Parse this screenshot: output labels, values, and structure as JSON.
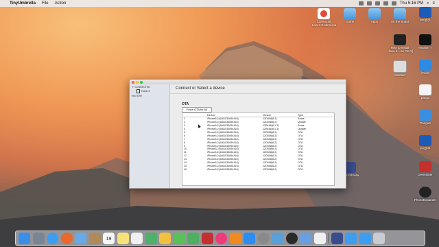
{
  "menubar": {
    "app_name": "TinyUmbrella",
    "items": [
      "File",
      "Action"
    ],
    "clock": "Thu 5:16 PM"
  },
  "desktop_icons": [
    {
      "label": "Cambodia\nLow-1.0.bdmv.ipa"
    },
    {
      "label": "Game"
    },
    {
      "label": "Apps"
    },
    {
      "label": "On the Board"
    },
    {
      "label": "PP助手"
    },
    {
      "label": "How to install\nJava 8....ac OS X]"
    },
    {
      "label": "evasi0n 7"
    },
    {
      "label": "Untitled"
    },
    {
      "label": "iTools"
    },
    {
      "label": "pangu"
    },
    {
      "label": "Pangu8"
    },
    {
      "label": "PP助手"
    },
    {
      "label": "TinyUmbrella"
    },
    {
      "label": "DeviMaker"
    },
    {
      "label": "PhoneExpander"
    }
  ],
  "window": {
    "sidebar": {
      "connected_header": "CONNECTED",
      "device_name": "Thanh 5",
      "history_header": "HISTORY"
    },
    "main_title": "Connect or Select a device",
    "section_title": "OTA",
    "fetch_button": "Fetch OTA for All",
    "table": {
      "columns": [
        "",
        "Device",
        "Version",
        "Type"
      ],
      "rows": [
        [
          "1",
          "iPhone5,2(4461033694416)",
          "12D508(8.2)",
          "Erase"
        ],
        [
          "2",
          "iPhone5,2(4461033694416)",
          "12D508(8.2)",
          "Update"
        ],
        [
          "3",
          "iPhone5,2(4461033694416)",
          "12B466(8.1.3)",
          "Erase"
        ],
        [
          "4",
          "iPhone5,2(4461033694416)",
          "12B466(8.1.3)",
          "Update"
        ],
        [
          "5",
          "iPhone5,2(4461033694416)",
          "12D508(8.2)",
          "OTA"
        ],
        [
          "6",
          "iPhone5,2(4461033694416)",
          "12D508(8.2)",
          "OTA"
        ],
        [
          "7",
          "iPhone5,2(4461033694416)",
          "12D508(8.2)",
          "OTA"
        ],
        [
          "8",
          "iPhone5,2(4461033694416)",
          "12D508(8.2)",
          "OTA"
        ],
        [
          "9",
          "iPhone5,2(4461033694416)",
          "12D508(8.2)",
          "OTA"
        ],
        [
          "10",
          "iPhone5,2(4461033694416)",
          "12D508(8.2)",
          "OTA"
        ],
        [
          "11",
          "iPhone5,2(4461033694416)",
          "12D508(8.2)",
          "OTA"
        ],
        [
          "12",
          "iPhone5,2(4461033694416)",
          "12D508(8.2)",
          "OTA"
        ],
        [
          "13",
          "iPhone5,2(4461033694416)",
          "12D508(8.2)",
          "OTA"
        ],
        [
          "14",
          "iPhone5,2(4461033694416)",
          "12D508(8.2)",
          "OTA"
        ],
        [
          "15",
          "iPhone5,2(4461033694416)",
          "12D508(8.2)",
          "OTA"
        ],
        [
          "16",
          "iPhone5,2(4461033694416)",
          "12D508(8.2)",
          "OTA"
        ]
      ]
    }
  },
  "dock": {
    "icons": [
      "finder-icon",
      "launchpad-icon",
      "safari-icon",
      "firefox-icon",
      "mail-icon",
      "contacts-icon",
      "calendar-icon",
      "notes-icon",
      "reminders-icon",
      "maps-icon",
      "photos-icon",
      "messages-icon",
      "facetime-icon",
      "photo-booth-icon",
      "itunes-icon",
      "ibooks-icon",
      "app-store-icon",
      "system-preferences-icon",
      "iphoto-icon",
      "quicktime-icon",
      "preview-icon",
      "textedit-icon",
      "tinyumbrella-icon",
      "downloads-folder-icon",
      "documents-folder-icon",
      "trash-icon"
    ],
    "calendar_day": "19"
  },
  "colors": {
    "traffic_red": "#fd5f57",
    "traffic_yellow": "#febc2e",
    "traffic_green": "#28c840"
  }
}
